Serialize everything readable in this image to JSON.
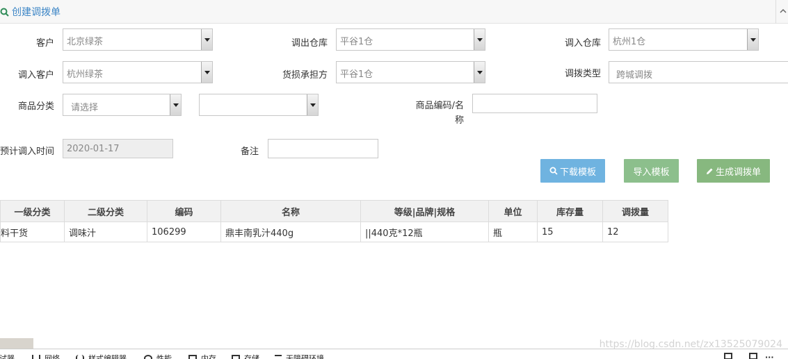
{
  "header": {
    "title": "创建调拨单"
  },
  "form": {
    "customer": {
      "label": "客户",
      "value": "北京绿茶"
    },
    "out_warehouse": {
      "label": "调出仓库",
      "value": "平谷1仓"
    },
    "in_warehouse": {
      "label": "调入仓库",
      "value": "杭州1仓"
    },
    "in_customer": {
      "label": "调入客户",
      "value": "杭州绿茶"
    },
    "loss_bearer": {
      "label": "货损承担方",
      "value": "平谷1仓"
    },
    "transfer_type": {
      "label": "调拨类型",
      "value": "跨城调拨"
    },
    "category": {
      "label": "商品分类",
      "placeholder": "请选择",
      "sub_value": ""
    },
    "product_code": {
      "label_line1": "商品编码/名",
      "label_line2": "称",
      "value": ""
    },
    "eta": {
      "label": "预计调入时间",
      "value": "2020-01-17"
    },
    "remark": {
      "label": "备注",
      "value": ""
    }
  },
  "actions": {
    "download": "下载模板",
    "import": "导入模板",
    "generate": "生成调拨单"
  },
  "colors": {
    "download": "#6fb3e0",
    "import": "#8cbf8c",
    "generate": "#87b87f",
    "title": "#3d86c6"
  },
  "table": {
    "headers": [
      "一级分类",
      "二级分类",
      "编码",
      "名称",
      "等级|品牌|规格",
      "单位",
      "库存量",
      "调拨量"
    ],
    "rows": [
      [
        "料干货",
        "调味汁",
        "106299",
        "鼎丰南乳汁440g",
        "||440克*12瓶",
        "瓶",
        "15",
        "12"
      ]
    ]
  },
  "devtools": {
    "tabs": [
      "调试器",
      "网络",
      "样式编辑器",
      "性能",
      "内存",
      "存储",
      "无障碍环境"
    ]
  },
  "watermark": "https://blog.csdn.net/zx13525079024"
}
